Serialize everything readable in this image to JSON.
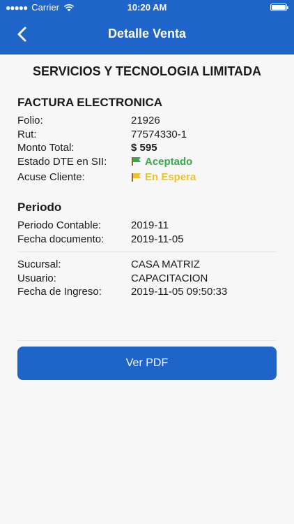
{
  "status_bar": {
    "carrier": "Carrier",
    "time": "10:20 AM"
  },
  "header": {
    "title": "Detalle Venta"
  },
  "company": "SERVICIOS Y TECNOLOGIA LIMITADA",
  "invoice": {
    "title": "FACTURA ELECTRONICA",
    "rows": [
      {
        "label": "Folio:",
        "value": "21926"
      },
      {
        "label": "Rut:",
        "value": "77574330-1"
      },
      {
        "label": "Monto Total:",
        "value": "$ 595"
      },
      {
        "label": "Estado DTE en SII:",
        "value": "Aceptado"
      },
      {
        "label": "Acuse Cliente:",
        "value": "En Espera"
      }
    ]
  },
  "period": {
    "title": "Periodo",
    "rows": [
      {
        "label": "Periodo Contable:",
        "value": "2019-11"
      },
      {
        "label": "Fecha documento:",
        "value": "2019-11-05"
      }
    ]
  },
  "other": {
    "rows": [
      {
        "label": "Sucursal:",
        "value": "CASA MATRIZ"
      },
      {
        "label": "Usuario:",
        "value": "CAPACITACION"
      },
      {
        "label": "Fecha de Ingreso:",
        "value": "2019-11-05 09:50:33"
      }
    ]
  },
  "actions": {
    "pdf_label": "Ver PDF"
  },
  "colors": {
    "primary": "#1f64c8",
    "accepted": "#3aa84a",
    "waiting": "#f0c02a"
  },
  "icons": {
    "back": "chevron-left-icon",
    "accepted": "flag-green-icon",
    "waiting": "flag-yellow-icon"
  }
}
